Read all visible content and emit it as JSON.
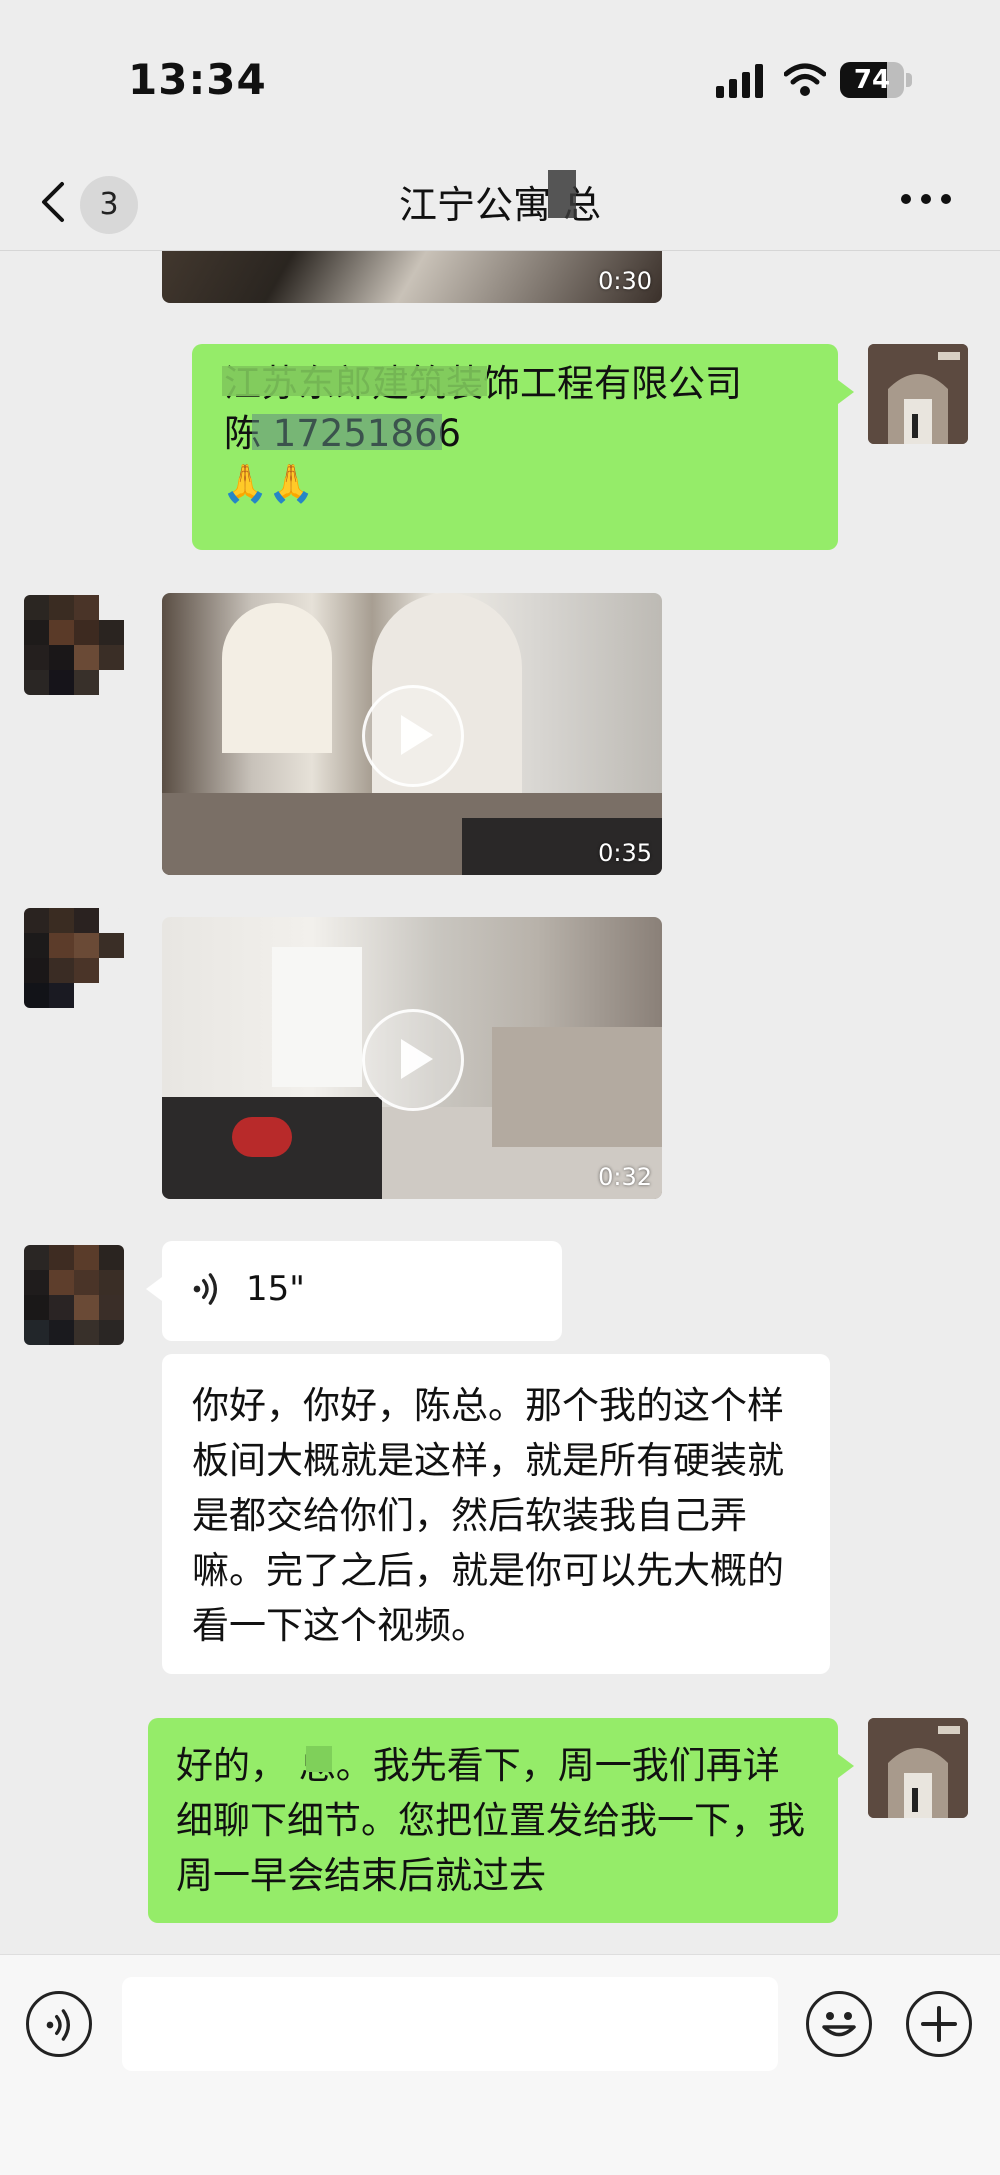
{
  "status_bar": {
    "time": "13:34",
    "battery_level": "74",
    "battery_fraction": 0.74
  },
  "nav": {
    "unread_count": "3",
    "title": "江宁公寓 总",
    "more_icon": "ellipsis-icon",
    "back_icon": "chevron-left-icon"
  },
  "messages": [
    {
      "type": "video",
      "side": "in",
      "duration": "0:30"
    },
    {
      "type": "text",
      "side": "out",
      "text_lines": [
        "江苏东郎建筑装饰工程有限公司",
        "陈 17251866"
      ],
      "emoji": "🙏🙏"
    },
    {
      "type": "video",
      "side": "in",
      "duration": "0:35"
    },
    {
      "type": "video",
      "side": "in",
      "duration": "0:32"
    },
    {
      "type": "voice",
      "side": "in",
      "duration": "15\""
    },
    {
      "type": "text",
      "side": "in",
      "text": "你好，你好，陈总。那个我的这个样板间大概就是这样，就是所有硬装就是都交给你们，然后软装我自己弄嘛。完了之后，就是你可以先大概的看一下这个视频。"
    },
    {
      "type": "text",
      "side": "out",
      "text": "好的， 总。我先看下，周一我们再详细聊下细节。您把位置发给我一下，我周一早会结束后就过去"
    }
  ],
  "input_bar": {
    "placeholder": "",
    "voice_icon": "voice-mode-icon",
    "emoji_icon": "emoji-icon",
    "plus_icon": "plus-icon"
  },
  "colors": {
    "background": "#ededed",
    "bubble_out": "#95ec69",
    "bubble_in": "#ffffff",
    "input_bar": "#f7f7f7"
  }
}
